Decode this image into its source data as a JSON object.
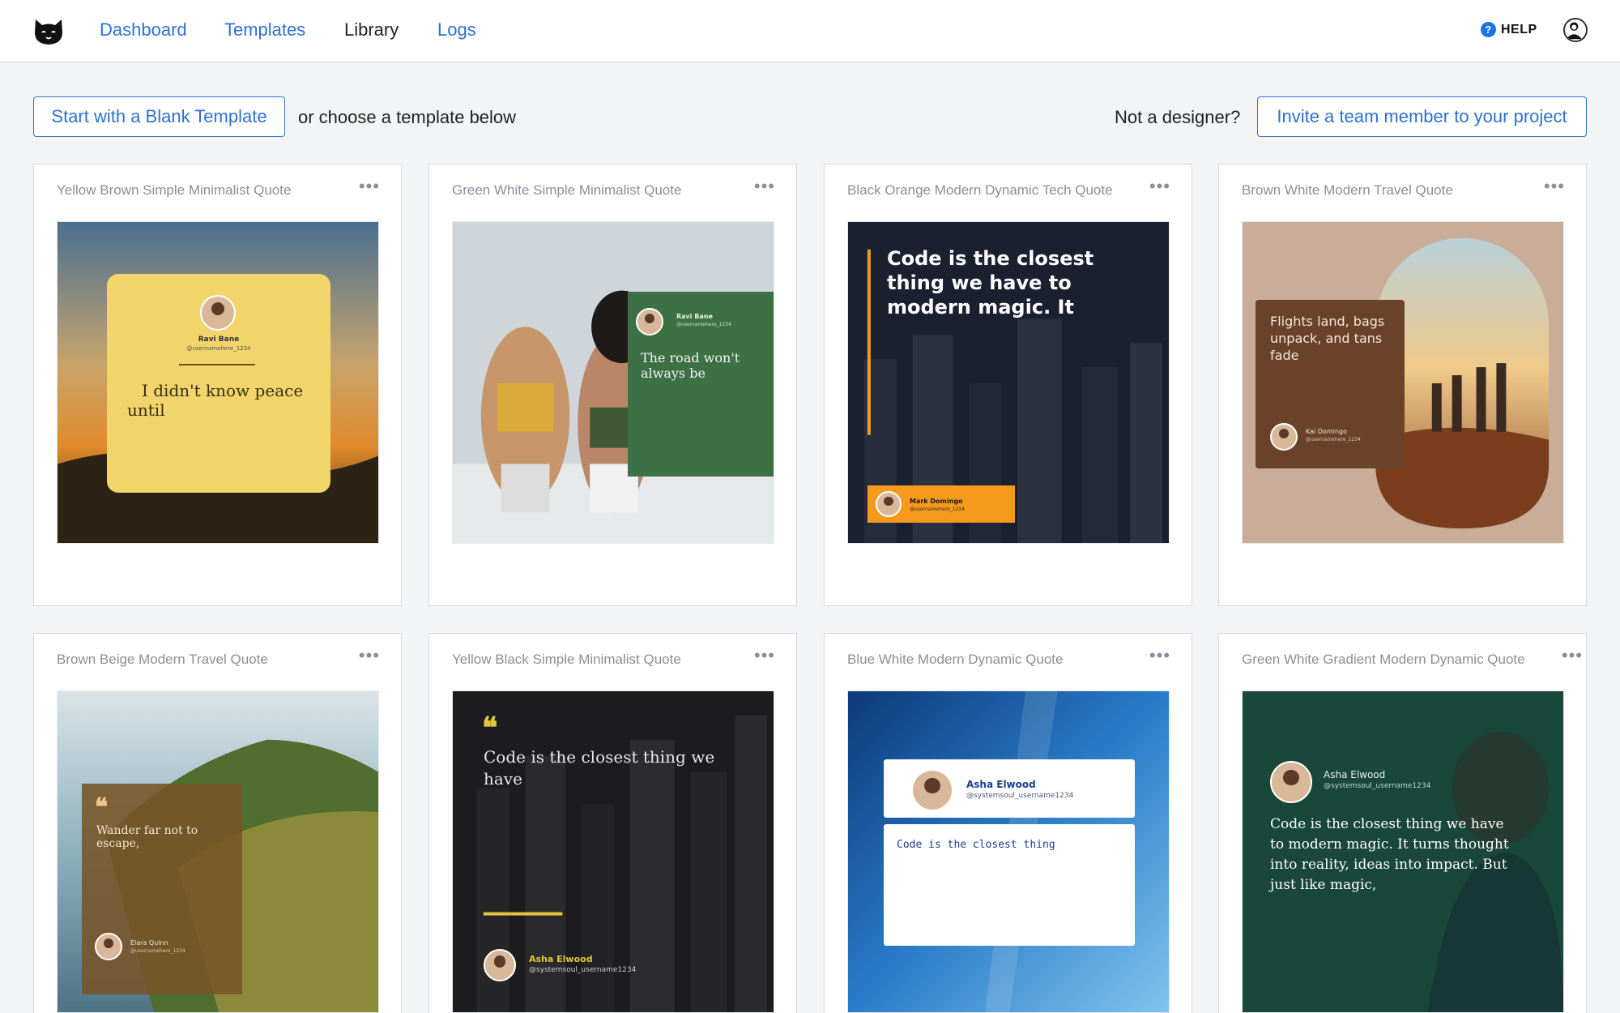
{
  "nav": {
    "items": [
      {
        "label": "Dashboard"
      },
      {
        "label": "Templates"
      },
      {
        "label": "Library"
      },
      {
        "label": "Logs"
      }
    ],
    "active": "Library",
    "help_label": "HELP",
    "logo_icon": "cat-face-icon"
  },
  "actions": {
    "blank_button": "Start with a Blank Template",
    "choose_text": "or choose a template below",
    "not_designer": "Not a designer?",
    "invite_button": "Invite a team member to your project"
  },
  "colors": {
    "link": "#2f6fd6",
    "background": "#f3f4f6"
  },
  "templates": [
    {
      "title": "Yellow Brown Simple Minimalist Quote",
      "preview": {
        "name": "Ravi Bane",
        "handle": "@usernamehere_1234",
        "quote": "I didn't know peace until"
      }
    },
    {
      "title": "Green White Simple Minimalist Quote",
      "preview": {
        "name": "Ravi Bane",
        "handle": "@usernamehere_1234",
        "quote": "The road won't always be"
      }
    },
    {
      "title": "Black Orange Modern Dynamic Tech Quote",
      "preview": {
        "name": "Mark Domingo",
        "handle": "@usernamehere_1234",
        "quote": "Code is the closest thing we have to modern magic. It"
      }
    },
    {
      "title": "Brown White Modern Travel Quote",
      "preview": {
        "name": "Kai Domingo",
        "handle": "@usernamehere_1234",
        "quote": "Flights land, bags unpack, and tans fade"
      }
    },
    {
      "title": "Brown Beige Modern Travel Quote",
      "preview": {
        "name": "Elara Quinn",
        "handle": "@usernamehere_1234",
        "quote": "Wander far not to escape,"
      }
    },
    {
      "title": "Yellow Black Simple Minimalist Quote",
      "preview": {
        "name": "Asha Elwood",
        "handle": "@systemsoul_username1234",
        "quote": "Code is the closest thing we have"
      }
    },
    {
      "title": "Blue White Modern Dynamic Quote",
      "preview": {
        "name": "Asha Elwood",
        "handle": "@systemsoul_username1234",
        "quote": "Code is the closest thing"
      }
    },
    {
      "title": "Green White Gradient Modern Dynamic Quote",
      "preview": {
        "name": "Asha Elwood",
        "handle": "@systemsoul_username1234",
        "quote": "Code is the closest thing we have to modern magic. It turns thought into reality, ideas into impact. But just like magic,"
      }
    }
  ],
  "icons": {
    "more": "more-horizontal-icon",
    "help": "help-circle-icon",
    "user": "user-avatar-icon",
    "quote_mark": "quote-mark-icon"
  },
  "glyphs": {
    "more": "•••",
    "help": "?",
    "quote_mark": "❝"
  }
}
